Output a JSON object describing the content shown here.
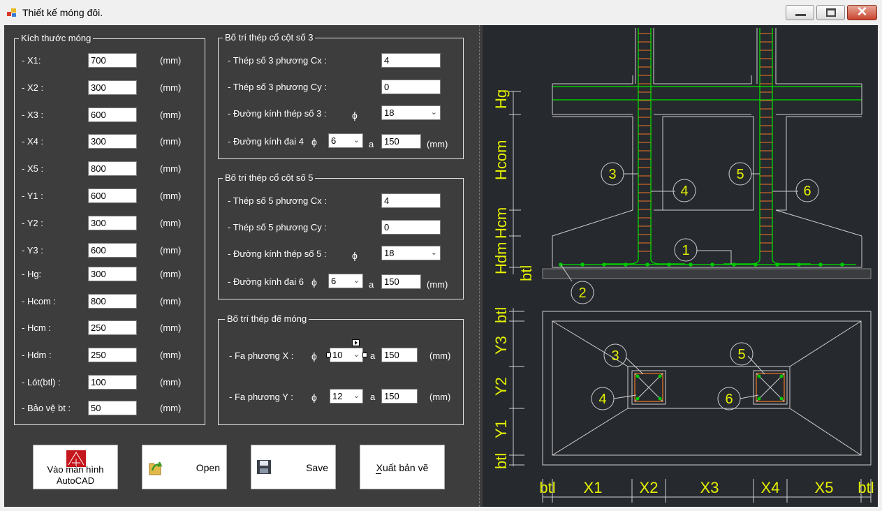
{
  "window": {
    "title": "Thiết kế móng đôi.",
    "close_glyph": "✕"
  },
  "dims": {
    "title": "Kích thước móng",
    "unit": "(mm)",
    "rows": [
      {
        "label": "- X1:",
        "value": "700"
      },
      {
        "label": "- X2 :",
        "value": "300"
      },
      {
        "label": "- X3 :",
        "value": "600"
      },
      {
        "label": "- X4 :",
        "value": "300"
      },
      {
        "label": "- X5 :",
        "value": "800"
      },
      {
        "label": "- Y1 :",
        "value": "600"
      },
      {
        "label": "- Y2 :",
        "value": "300"
      },
      {
        "label": "- Y3 :",
        "value": "600"
      },
      {
        "label": "- Hg:",
        "value": "300"
      },
      {
        "label": "- Hcom :",
        "value": "800"
      },
      {
        "label": "- Hcm :",
        "value": "250"
      },
      {
        "label": "- Hdm :",
        "value": "250"
      },
      {
        "label": "- Lót(btl) :",
        "value": "100"
      },
      {
        "label": "- Bảo vệ bt :",
        "value": "50"
      }
    ]
  },
  "col3": {
    "title": "Bố trí thép cổ cột số 3",
    "cx_label": "- Thép số 3 phương Cx :",
    "cx_value": "4",
    "cy_label": "- Thép số 3 phương Cy :",
    "cy_value": "0",
    "dia_label": "- Đường kính thép số 3 :",
    "dia_value": "18",
    "tie_label": "- Đường kính đai 4",
    "tie_value": "6",
    "a_label": "a",
    "spacing_value": "150",
    "unit": "(mm)"
  },
  "col5": {
    "title": "Bố trí thép cổ cột số 5",
    "cx_label": "- Thép số 5 phương Cx :",
    "cx_value": "4",
    "cy_label": "- Thép số 5 phương Cy :",
    "cy_value": "0",
    "dia_label": "- Đường kính thép số 5 :",
    "dia_value": "18",
    "tie_label": "- Đường kính đai 6",
    "tie_value": "6",
    "a_label": "a",
    "spacing_value": "150",
    "unit": "(mm)"
  },
  "base": {
    "title": "Bố trí thép đế móng",
    "fx_label": "- Fa phương X :",
    "fx_value": "10",
    "fx_spacing": "150",
    "fy_label": "- Fa phương Y :",
    "fy_value": "12",
    "fy_spacing": "150",
    "a_label": "a",
    "unit": "(mm)"
  },
  "phi_symbol": "ϕ",
  "buttons": {
    "autocad": "Vào màn hình\nAutoCAD",
    "open": "Open",
    "save": "Save",
    "export": "Xuất bản vẽ"
  },
  "drawing": {
    "elevation_labels": [
      "Hg",
      "Hcom",
      "Hcm",
      "Hdm",
      "btl"
    ],
    "plan_labels_y": [
      "btl",
      "Y3",
      "Y2",
      "Y1",
      "btl"
    ],
    "plan_labels_x": [
      "btl",
      "X1",
      "X2",
      "X3",
      "X4",
      "X5",
      "btl"
    ],
    "elevation_markers": [
      "3",
      "4",
      "5",
      "6",
      "1",
      "2"
    ],
    "plan_markers": [
      "3",
      "4",
      "5",
      "6"
    ]
  },
  "colors": {
    "client_bg": "#3d3d3d",
    "drawing_bg": "#26292e",
    "rebar_green": "#00c800",
    "tie_orange": "#c86a28",
    "cad_yellow": "#e4f000"
  }
}
